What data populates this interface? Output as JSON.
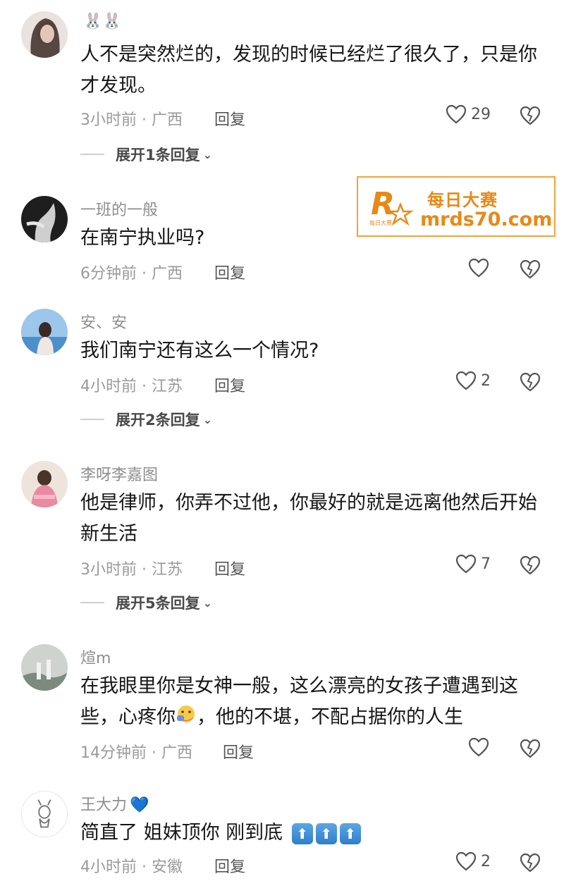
{
  "comments": [
    {
      "name": "",
      "name_emoji": "🐰🐰",
      "text": "人不是突然烂的，发现的时候已经烂了很久了，只是你才发现。",
      "time": "3小时前",
      "location": "广西",
      "reply_label": "回复",
      "likes": "29",
      "expand": "展开1条回复"
    },
    {
      "name": "一班的一般",
      "text": "在南宁执业吗?",
      "time": "6分钟前",
      "location": "广西",
      "reply_label": "回复",
      "likes": ""
    },
    {
      "name": "安、安",
      "text": "我们南宁还有这么一个情况?",
      "time": "4小时前",
      "location": "江苏",
      "reply_label": "回复",
      "likes": "2",
      "expand": "展开2条回复"
    },
    {
      "name": "李呀李嘉图",
      "text": "他是律师，你弄不过他，你最好的就是远离他然后开始新生活",
      "time": "3小时前",
      "location": "江苏",
      "reply_label": "回复",
      "likes": "7",
      "expand": "展开5条回复"
    },
    {
      "name": "煊m",
      "text_before_emoji": "在我眼里你是女神一般，这么漂亮的女孩子遭遇到这些，心疼你",
      "text_after_emoji": "，他的不堪，不配占据你的人生",
      "time": "14分钟前",
      "location": "广西",
      "reply_label": "回复",
      "likes": ""
    },
    {
      "name": "王大力",
      "name_badge": "💙",
      "text": "简直了 姐妹顶你 刚到底",
      "arrow_emoji": "⬆",
      "time": "4小时前",
      "location": "安徽",
      "reply_label": "回复",
      "likes": "2"
    }
  ],
  "watermark": {
    "line1": "每日大赛",
    "line2": "mrds70.com",
    "logo_letter": "R",
    "logo_caption": "每日大赛"
  },
  "colors": {
    "accent": "#e88917",
    "meta": "#9a9a9a"
  },
  "icons": {
    "like": "heart-outline-icon",
    "dislike": "broken-heart-icon",
    "expand": "chevron-down-icon"
  }
}
